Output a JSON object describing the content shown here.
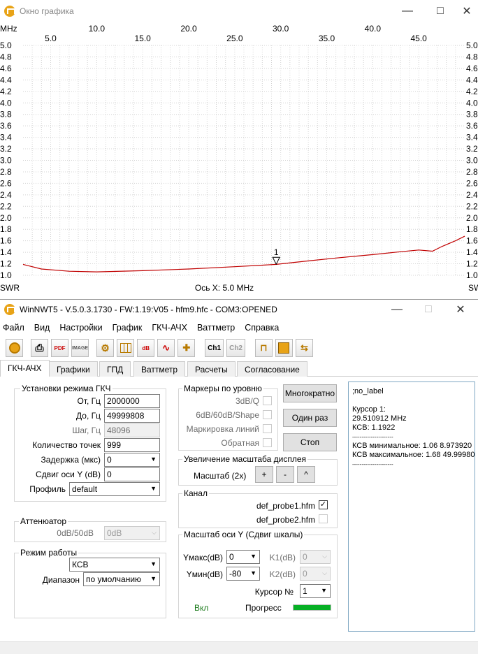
{
  "graph_window": {
    "title": "Окно графика",
    "mhz_label": "MHz",
    "swr_label": "SWR",
    "x_axis_caption": "Ось X: 5.0 MHz",
    "marker_label": "1",
    "top_ticks_upper": [
      "10.0",
      "20.0",
      "30.0",
      "40.0"
    ],
    "top_ticks_lower": [
      "5.0",
      "15.0",
      "25.0",
      "35.0",
      "45.0"
    ],
    "y_ticks": [
      "5.0",
      "4.8",
      "4.6",
      "4.4",
      "4.2",
      "4.0",
      "3.8",
      "3.6",
      "3.4",
      "3.2",
      "3.0",
      "2.8",
      "2.6",
      "2.4",
      "2.2",
      "2.0",
      "1.8",
      "1.6",
      "1.4",
      "1.2",
      "1.0"
    ]
  },
  "chart_data": {
    "type": "line",
    "xlabel": "Ось X: 5.0 MHz",
    "ylabel": "SWR",
    "xlim": [
      2.0,
      49.999808
    ],
    "ylim": [
      1.0,
      5.0
    ],
    "series": [
      {
        "color": "#c00000",
        "x": [
          2.0,
          4.0,
          7.0,
          10.0,
          15.0,
          20.0,
          25.0,
          29.5,
          33.0,
          36.0,
          40.0,
          43.0,
          45.0,
          46.5,
          47.5,
          49.0,
          50.0
        ],
        "y": [
          1.19,
          1.11,
          1.07,
          1.06,
          1.08,
          1.11,
          1.15,
          1.19,
          1.25,
          1.3,
          1.36,
          1.41,
          1.44,
          1.42,
          1.5,
          1.6,
          1.68
        ]
      }
    ]
  },
  "main_window": {
    "title": "WinNWT5 - V.5.0.3.1730 - FW:1.19:V05 - hfm9.hfc - COM3:OPENED",
    "menu": [
      "Файл",
      "Вид",
      "Настройки",
      "График",
      "ГКЧ-АЧХ",
      "Ваттметр",
      "Справка"
    ],
    "toolbar": {
      "pdf_label": "PDF",
      "image_label": "IMAGE",
      "db_label": "dB",
      "ch1_label": "Ch1",
      "ch2_label": "Ch2"
    },
    "tabs": [
      "ГКЧ-АЧХ",
      "Графики",
      "ГПД",
      "Ваттметр",
      "Расчеты",
      "Согласование"
    ]
  },
  "gkch_settings": {
    "title": "Установки режима ГКЧ",
    "from_label": "От, Гц",
    "from_value": "2000000",
    "to_label": "До, Гц",
    "to_value": "49999808",
    "step_label": "Шаг, Гц",
    "step_value": "48096",
    "points_label": "Количество точек",
    "points_value": "999",
    "delay_label": "Задержка (мкс)",
    "delay_value": "0",
    "yshift_label": "Сдвиг оси Y (dB)",
    "yshift_value": "0",
    "profile_label": "Профиль",
    "profile_value": "default"
  },
  "attenuator": {
    "title": "Аттенюатор",
    "label": "0dB/50dB",
    "value": "0dB"
  },
  "mode": {
    "title": "Режим работы",
    "mode_value": "КСВ",
    "range_label": "Диапазон",
    "range_value": "по умолчанию"
  },
  "level_markers": {
    "title": "Маркеры по уровню",
    "items": [
      {
        "label": "3dB/Q"
      },
      {
        "label": "6dB/60dB/Shape"
      },
      {
        "label": "Маркировка линий"
      },
      {
        "label": "Обратная"
      }
    ]
  },
  "run_buttons": {
    "repeat": "Многократно",
    "once": "Один раз",
    "stop": "Стоп"
  },
  "display_scale": {
    "title": "Увеличение масштаба дисплея",
    "label": "Масштаб (2x)",
    "plus": "+",
    "minus": "-",
    "caret": "^"
  },
  "channel": {
    "title": "Канал",
    "probe1": "def_probe1.hfm",
    "probe1_checked": "✓",
    "probe2": "def_probe2.hfm"
  },
  "y_scale": {
    "title": "Масштаб оси Y (Сдвиг шкалы)",
    "ymax_label": "Yмакс(dB)",
    "ymax_value": "0",
    "ymin_label": "Yмин(dB)",
    "ymin_value": "-80",
    "k1_label": "K1(dB)",
    "k1_value": "0",
    "k2_label": "K2(dB)",
    "k2_value": "0",
    "cursor_label": "Курсор №",
    "cursor_value": "1",
    "on_label": "Вкл",
    "progress_label": "Прогресс",
    "progress": 1.0
  },
  "info_panel": {
    "line1": ";no_label",
    "line2": "Курсор 1:",
    "line3": "29.510912 MHz",
    "line4": "КСВ: 1.1922",
    "sep": "----------------------",
    "line5": "КСВ минимальное: 1.06  8.973920",
    "line6": "КСВ максимальное: 1.68  49.99980"
  }
}
